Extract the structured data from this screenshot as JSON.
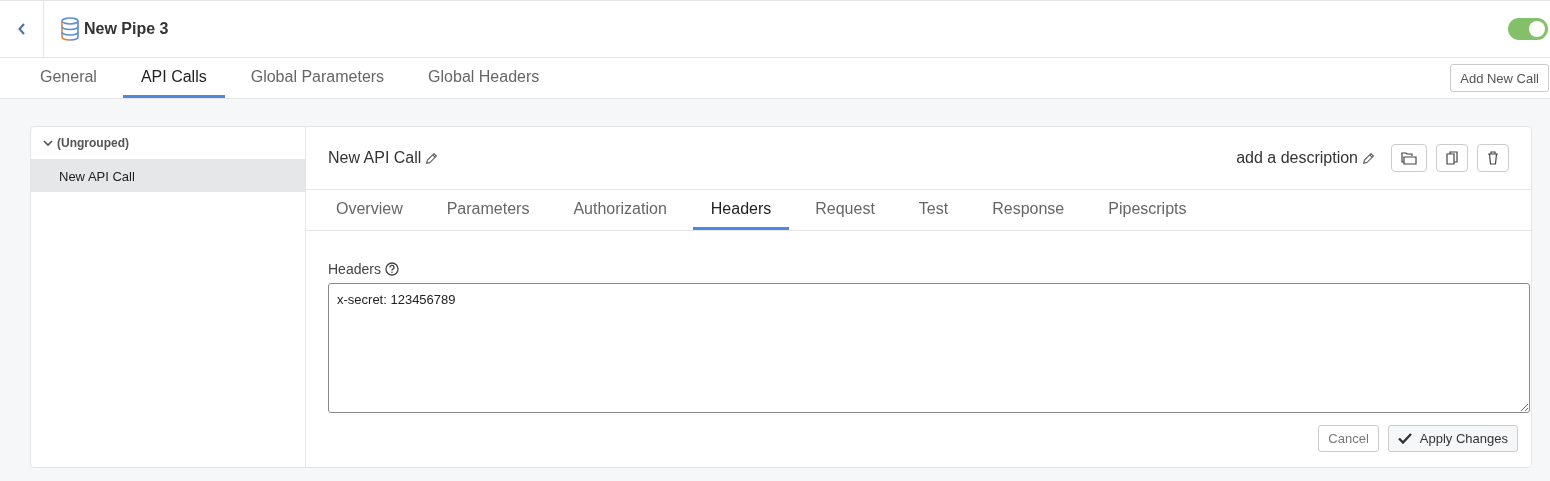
{
  "header": {
    "title": "New Pipe 3",
    "enabled": true
  },
  "tabs": [
    {
      "label": "General",
      "selected": false
    },
    {
      "label": "API Calls",
      "selected": true
    },
    {
      "label": "Global Parameters",
      "selected": false
    },
    {
      "label": "Global Headers",
      "selected": false
    }
  ],
  "add_button": "Add New Call",
  "sidebar": {
    "groups": [
      {
        "label": "(Ungrouped)",
        "expanded": true,
        "children": [
          {
            "label": "New API Call",
            "selected": true
          }
        ]
      }
    ]
  },
  "call": {
    "title": "New API Call",
    "description": "add a description"
  },
  "call_tabs": [
    {
      "label": "Overview",
      "selected": false
    },
    {
      "label": "Parameters",
      "selected": false
    },
    {
      "label": "Authorization",
      "selected": false
    },
    {
      "label": "Headers",
      "selected": true
    },
    {
      "label": "Request",
      "selected": false
    },
    {
      "label": "Test",
      "selected": false
    },
    {
      "label": "Response",
      "selected": false
    },
    {
      "label": "Pipescripts",
      "selected": false
    }
  ],
  "headers_field": {
    "label": "Headers",
    "value": "x-secret: 123456789"
  },
  "buttons": {
    "cancel": "Cancel",
    "apply": "Apply Changes"
  }
}
